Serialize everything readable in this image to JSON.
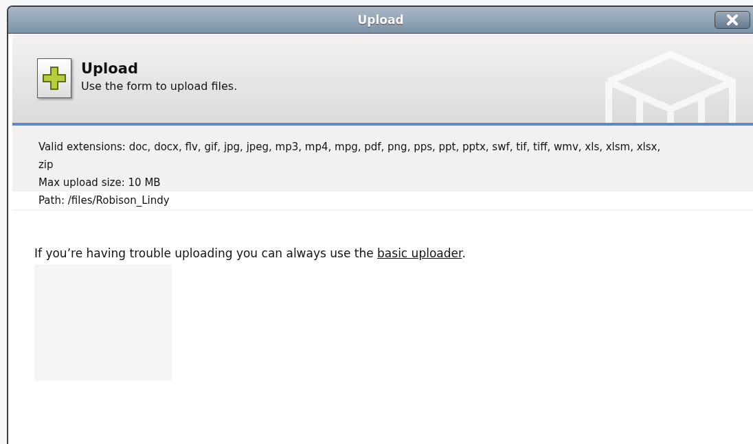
{
  "window": {
    "title": "Upload"
  },
  "header": {
    "title": "Upload",
    "subtitle": "Use the form to upload files."
  },
  "info": [
    "Valid extensions: doc, docx, flv, gif, jpg, jpeg, mp3, mp4, mpg, pdf, png, pps, ppt, pptx, swf, tif, tiff, wmv, xls, xlsm, xlsx, zip",
    "Max upload size: 10 MB",
    "Path: /files/Robison_Lindy"
  ],
  "trouble_note": {
    "text": "If you’re having trouble uploading you can always use the ",
    "link": "basic uploader",
    "end": "."
  }
}
